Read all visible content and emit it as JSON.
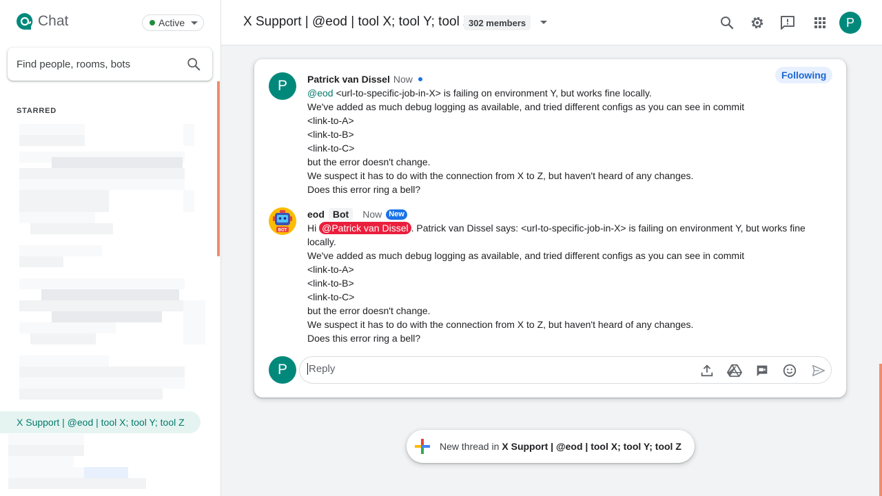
{
  "app": {
    "logo_text": "Chat",
    "status": "Active"
  },
  "sidebar": {
    "search_placeholder": "Find people, rooms, bots",
    "starred_label": "STARRED",
    "active_room": "X Support | @eod | tool X; tool Y; tool Z"
  },
  "header": {
    "room_title": "X Support | @eod | tool X; tool Y; tool Z",
    "members": "302 members",
    "user_initial": "P"
  },
  "thread": {
    "following_label": "Following",
    "messages": [
      {
        "sender": "Patrick van Dissel",
        "time": "Now",
        "avatar_initial": "P",
        "mention": "@eod",
        "lines": [
          " <url-to-specific-job-in-X> is failing on environment Y, but works fine locally.",
          "We've added as much debug logging as available, and tried different configs as you can see in commit",
          "<link-to-A>",
          "<link-to-B>",
          "<link-to-C>",
          "but the error doesn't change.",
          "We suspect it has to do with the connection from X to Z, but haven't heard of any changes.",
          "Does this error ring a bell?"
        ]
      },
      {
        "sender": "eod",
        "bot_label": "Bot",
        "time": "Now",
        "badge": "New",
        "greeting": "Hi ",
        "mention": "@Patrick van Dissel",
        "first_line_rest": ". Patrick van Dissel says:  <url-to-specific-job-in-X> is failing on environment Y, but works fine",
        "lines": [
          "locally.",
          "We've added as much debug logging as available, and tried different configs as you can see in commit",
          "<link-to-A>",
          "<link-to-B>",
          "<link-to-C>",
          "but the error doesn't change.",
          "We suspect it has to do with the connection from X to Z, but haven't heard of any changes.",
          "Does this error ring a bell?"
        ]
      }
    ],
    "reply_placeholder": "Reply",
    "reply_avatar_initial": "P"
  },
  "new_thread": {
    "prefix": "New thread in",
    "room": "X Support | @eod | tool X; tool Y; tool Z"
  },
  "colors": {
    "accent_teal": "#00897b",
    "mention_pill": "#ea1f3d",
    "scroll_accent": "#f28b6b",
    "link_blue": "#1a73e8"
  }
}
